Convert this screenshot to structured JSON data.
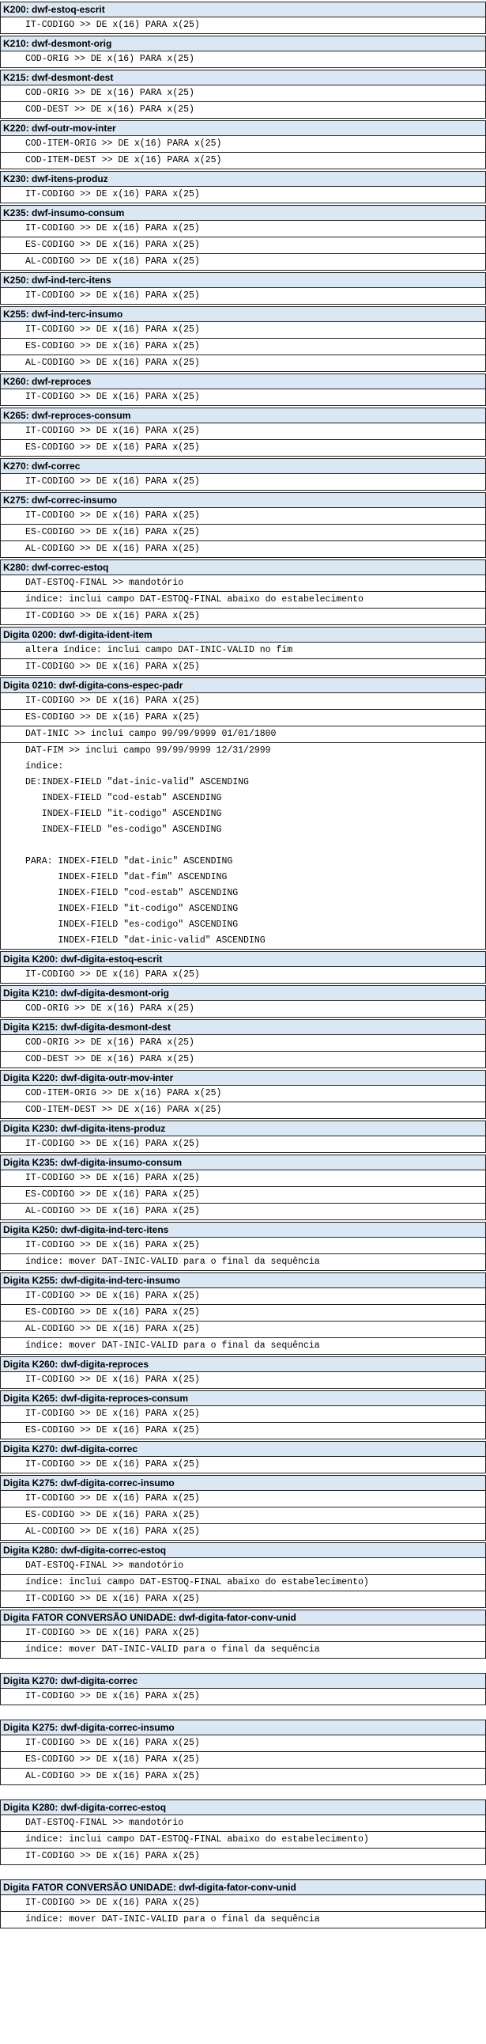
{
  "sections": [
    {
      "title": "K200: dwf-estoq-escrit",
      "rows": [
        {
          "text": "IT-CODIGO >> DE x(16) PARA x(25)"
        }
      ]
    },
    {
      "title": "K210: dwf-desmont-orig",
      "rows": [
        {
          "text": "COD-ORIG >> DE x(16) PARA x(25)"
        }
      ]
    },
    {
      "title": "K215: dwf-desmont-dest",
      "rows": [
        {
          "text": "COD-ORIG >> DE x(16) PARA x(25)"
        },
        {
          "text": "COD-DEST >> DE x(16) PARA x(25)"
        }
      ]
    },
    {
      "title": "K220: dwf-outr-mov-inter",
      "rows": [
        {
          "text": "COD-ITEM-ORIG >> DE x(16) PARA x(25)"
        },
        {
          "text": "COD-ITEM-DEST >> DE x(16) PARA x(25)"
        }
      ]
    },
    {
      "title": "K230: dwf-itens-produz",
      "rows": [
        {
          "text": "IT-CODIGO >> DE x(16) PARA x(25)"
        }
      ]
    },
    {
      "title": "K235: dwf-insumo-consum",
      "rows": [
        {
          "text": "IT-CODIGO >> DE x(16) PARA x(25)"
        },
        {
          "text": "ES-CODIGO >> DE x(16) PARA x(25)"
        },
        {
          "text": "AL-CODIGO >> DE x(16) PARA x(25)"
        }
      ]
    },
    {
      "title": "K250: dwf-ind-terc-itens",
      "rows": [
        {
          "text": "IT-CODIGO >> DE x(16) PARA x(25)"
        }
      ]
    },
    {
      "title": "K255: dwf-ind-terc-insumo",
      "rows": [
        {
          "text": "IT-CODIGO >> DE x(16) PARA x(25)"
        },
        {
          "text": "ES-CODIGO >> DE x(16) PARA x(25)"
        },
        {
          "text": "AL-CODIGO >> DE x(16) PARA x(25)"
        }
      ]
    },
    {
      "title": "K260: dwf-reproces",
      "rows": [
        {
          "text": "IT-CODIGO >> DE x(16) PARA x(25)"
        }
      ]
    },
    {
      "title": "K265: dwf-reproces-consum",
      "rows": [
        {
          "text": "IT-CODIGO >> DE x(16) PARA x(25)"
        },
        {
          "text": "ES-CODIGO >> DE x(16) PARA x(25)"
        }
      ]
    },
    {
      "title": "K270: dwf-correc",
      "rows": [
        {
          "text": "IT-CODIGO >> DE x(16) PARA x(25)"
        }
      ]
    },
    {
      "title": "K275: dwf-correc-insumo",
      "rows": [
        {
          "text": "IT-CODIGO >> DE x(16) PARA x(25)"
        },
        {
          "text": "ES-CODIGO >> DE x(16) PARA x(25)"
        },
        {
          "text": "AL-CODIGO >> DE x(16) PARA x(25)"
        }
      ]
    },
    {
      "title": "K280: dwf-correc-estoq",
      "rows": [
        {
          "text": "DAT-ESTOQ-FINAL >> mandotório"
        },
        {
          "text": "índice: inclui campo DAT-ESTOQ-FINAL abaixo do estabelecimento"
        },
        {
          "text": "IT-CODIGO >> DE x(16) PARA x(25)"
        }
      ]
    },
    {
      "title": "Digita 0200: dwf-digita-ident-item",
      "rows": [
        {
          "text": "altera índice: inclui campo DAT-INIC-VALID no fim"
        },
        {
          "text": "IT-CODIGO >> DE x(16) PARA x(25)"
        }
      ]
    },
    {
      "title": "Digita 0210: dwf-digita-cons-espec-padr",
      "rows": [
        {
          "text": "IT-CODIGO >> DE x(16) PARA x(25)"
        },
        {
          "text": "ES-CODIGO >> DE x(16) PARA x(25)"
        },
        {
          "text": "DAT-INIC >> inclui campo 99/99/9999 01/01/1800"
        },
        {
          "text": "DAT-FIM >> inclui campo 99/99/9999 12/31/2999"
        },
        {
          "text": "índice:",
          "plain": true
        },
        {
          "text": "DE:INDEX-FIELD \"dat-inic-valid\" ASCENDING",
          "plain": true
        },
        {
          "text": "   INDEX-FIELD \"cod-estab\" ASCENDING",
          "plain": true
        },
        {
          "text": "   INDEX-FIELD \"it-codigo\" ASCENDING",
          "plain": true
        },
        {
          "text": "   INDEX-FIELD \"es-codigo\" ASCENDING",
          "plain": true
        },
        {
          "text": "",
          "plain": true
        },
        {
          "text": "PARA: INDEX-FIELD \"dat-inic\" ASCENDING",
          "plain": true
        },
        {
          "text": "      INDEX-FIELD \"dat-fim\" ASCENDING",
          "plain": true
        },
        {
          "text": "      INDEX-FIELD \"cod-estab\" ASCENDING",
          "plain": true
        },
        {
          "text": "      INDEX-FIELD \"it-codigo\" ASCENDING",
          "plain": true
        },
        {
          "text": "      INDEX-FIELD \"es-codigo\" ASCENDING",
          "plain": true
        },
        {
          "text": "      INDEX-FIELD \"dat-inic-valid\" ASCENDING",
          "plain": true
        }
      ]
    },
    {
      "title": "Digita K200: dwf-digita-estoq-escrit",
      "rows": [
        {
          "text": "IT-CODIGO >> DE x(16) PARA x(25)"
        }
      ]
    },
    {
      "title": "Digita K210: dwf-digita-desmont-orig",
      "rows": [
        {
          "text": "COD-ORIG >> DE x(16) PARA x(25)"
        }
      ]
    },
    {
      "title": "Digita K215: dwf-digita-desmont-dest",
      "rows": [
        {
          "text": "COD-ORIG >> DE x(16) PARA x(25)"
        },
        {
          "text": "COD-DEST >> DE x(16) PARA x(25)"
        }
      ]
    },
    {
      "title": "Digita K220: dwf-digita-outr-mov-inter",
      "rows": [
        {
          "text": "COD-ITEM-ORIG >> DE x(16) PARA x(25)"
        },
        {
          "text": "COD-ITEM-DEST >> DE x(16) PARA x(25)"
        }
      ]
    },
    {
      "title": "Digita K230: dwf-digita-itens-produz",
      "rows": [
        {
          "text": "IT-CODIGO >> DE x(16) PARA x(25)"
        }
      ]
    },
    {
      "title": "Digita K235: dwf-digita-insumo-consum",
      "rows": [
        {
          "text": "IT-CODIGO >> DE x(16) PARA x(25)"
        },
        {
          "text": "ES-CODIGO >> DE x(16) PARA x(25)"
        },
        {
          "text": "AL-CODIGO >> DE x(16) PARA x(25)"
        }
      ]
    },
    {
      "title": "Digita K250: dwf-digita-ind-terc-itens",
      "rows": [
        {
          "text": "IT-CODIGO >> DE x(16) PARA x(25)"
        },
        {
          "text": "índice: mover DAT-INIC-VALID para o final da sequência"
        }
      ]
    },
    {
      "title": "Digita K255: dwf-digita-ind-terc-insumo",
      "rows": [
        {
          "text": "IT-CODIGO >> DE x(16) PARA x(25)"
        },
        {
          "text": "ES-CODIGO >> DE x(16) PARA x(25)"
        },
        {
          "text": "AL-CODIGO >> DE x(16) PARA x(25)"
        },
        {
          "text": "índice: mover DAT-INIC-VALID para o final da sequência"
        }
      ]
    },
    {
      "title": "Digita K260: dwf-digita-reproces",
      "rows": [
        {
          "text": "IT-CODIGO >> DE x(16) PARA x(25)"
        }
      ]
    },
    {
      "title": "Digita K265: dwf-digita-reproces-consum",
      "rows": [
        {
          "text": "IT-CODIGO >> DE x(16) PARA x(25)"
        },
        {
          "text": "ES-CODIGO >> DE x(16) PARA x(25)"
        }
      ]
    },
    {
      "title": "Digita K270: dwf-digita-correc",
      "rows": [
        {
          "text": "IT-CODIGO >> DE x(16) PARA x(25)"
        }
      ]
    },
    {
      "title": "Digita K275: dwf-digita-correc-insumo",
      "rows": [
        {
          "text": "IT-CODIGO >> DE x(16) PARA x(25)"
        },
        {
          "text": "ES-CODIGO >> DE x(16) PARA x(25)"
        },
        {
          "text": "AL-CODIGO >> DE x(16) PARA x(25)"
        }
      ]
    },
    {
      "title": "Digita K280: dwf-digita-correc-estoq",
      "rows": [
        {
          "text": "DAT-ESTOQ-FINAL >> mandotório"
        },
        {
          "text": "índice: inclui campo DAT-ESTOQ-FINAL abaixo do estabelecimento)"
        },
        {
          "text": "IT-CODIGO >> DE x(16) PARA x(25)"
        }
      ]
    },
    {
      "title": "Digita FATOR CONVERSÃO UNIDADE: dwf-digita-fator-conv-unid",
      "rows": [
        {
          "text": "IT-CODIGO >> DE x(16) PARA x(25)"
        },
        {
          "text": "índice: mover DAT-INIC-VALID para o final da sequência"
        }
      ]
    },
    {
      "title": "Digita K270: dwf-digita-correc",
      "rows": [
        {
          "text": "IT-CODIGO >> DE x(16) PARA x(25)"
        }
      ]
    },
    {
      "title": "Digita K275: dwf-digita-correc-insumo",
      "rows": [
        {
          "text": "IT-CODIGO >> DE x(16) PARA x(25)"
        },
        {
          "text": "ES-CODIGO >> DE x(16) PARA x(25)"
        },
        {
          "text": "AL-CODIGO >> DE x(16) PARA x(25)"
        }
      ]
    },
    {
      "title": "Digita K280: dwf-digita-correc-estoq",
      "rows": [
        {
          "text": "DAT-ESTOQ-FINAL >> mandotório"
        },
        {
          "text": "índice: inclui campo DAT-ESTOQ-FINAL abaixo do estabelecimento)"
        },
        {
          "text": "IT-CODIGO >> DE x(16) PARA x(25)"
        }
      ]
    },
    {
      "title": "Digita FATOR CONVERSÃO UNIDADE: dwf-digita-fator-conv-unid",
      "rows": [
        {
          "text": "IT-CODIGO >> DE x(16) PARA x(25)"
        },
        {
          "text": "índice: mover DAT-INIC-VALID para o final da sequência"
        }
      ]
    }
  ]
}
